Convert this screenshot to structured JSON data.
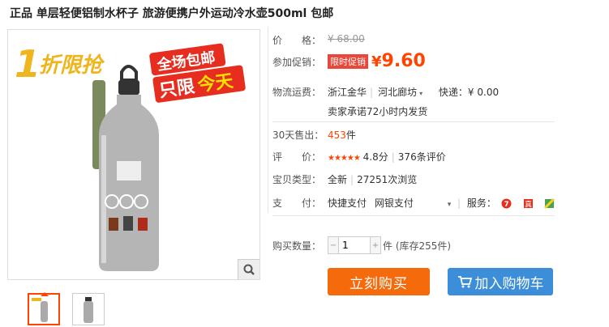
{
  "product": {
    "title": "正品 单层轻便铝制水杯子 旅游便携户外运动冷水壶500ml 包邮",
    "image": {
      "banner_left": "1折限抢",
      "banner_right_line1": "全场包邮",
      "banner_right_line2a": "只限",
      "banner_right_line2b": "今天"
    }
  },
  "price": {
    "label": "价　　格：",
    "original": "¥ 68.00"
  },
  "promo": {
    "label": "参加促销：",
    "badge": "限时促销",
    "currency": "¥",
    "amount": "9.60"
  },
  "shipping": {
    "label": "物流运费：",
    "from": "浙江金华",
    "to": "河北廊坊",
    "express": "快递：¥ 0.00",
    "note": "卖家承诺72小时内发货"
  },
  "sales": {
    "label": "30天售出：",
    "count": "453",
    "unit": "件"
  },
  "rating": {
    "label": "评　　价：",
    "stars": "★★★★★",
    "score": "4.8分",
    "reviews": "376条评价"
  },
  "item_type": {
    "label": "宝贝类型：",
    "condition": "全新",
    "views": "27251次浏览"
  },
  "payment": {
    "label": "支　　付：",
    "method1": "快捷支付",
    "method2": "网银支付",
    "service_label": "服务："
  },
  "quantity": {
    "label": "购买数量：",
    "value": "1",
    "stock": "件 (库存255件)"
  },
  "actions": {
    "buy_now": "立刻购买",
    "add_cart": "加入购物车"
  },
  "colors": {
    "accent": "#ff4400",
    "buy": "#f56b0c",
    "cart": "#3d8ed8"
  }
}
